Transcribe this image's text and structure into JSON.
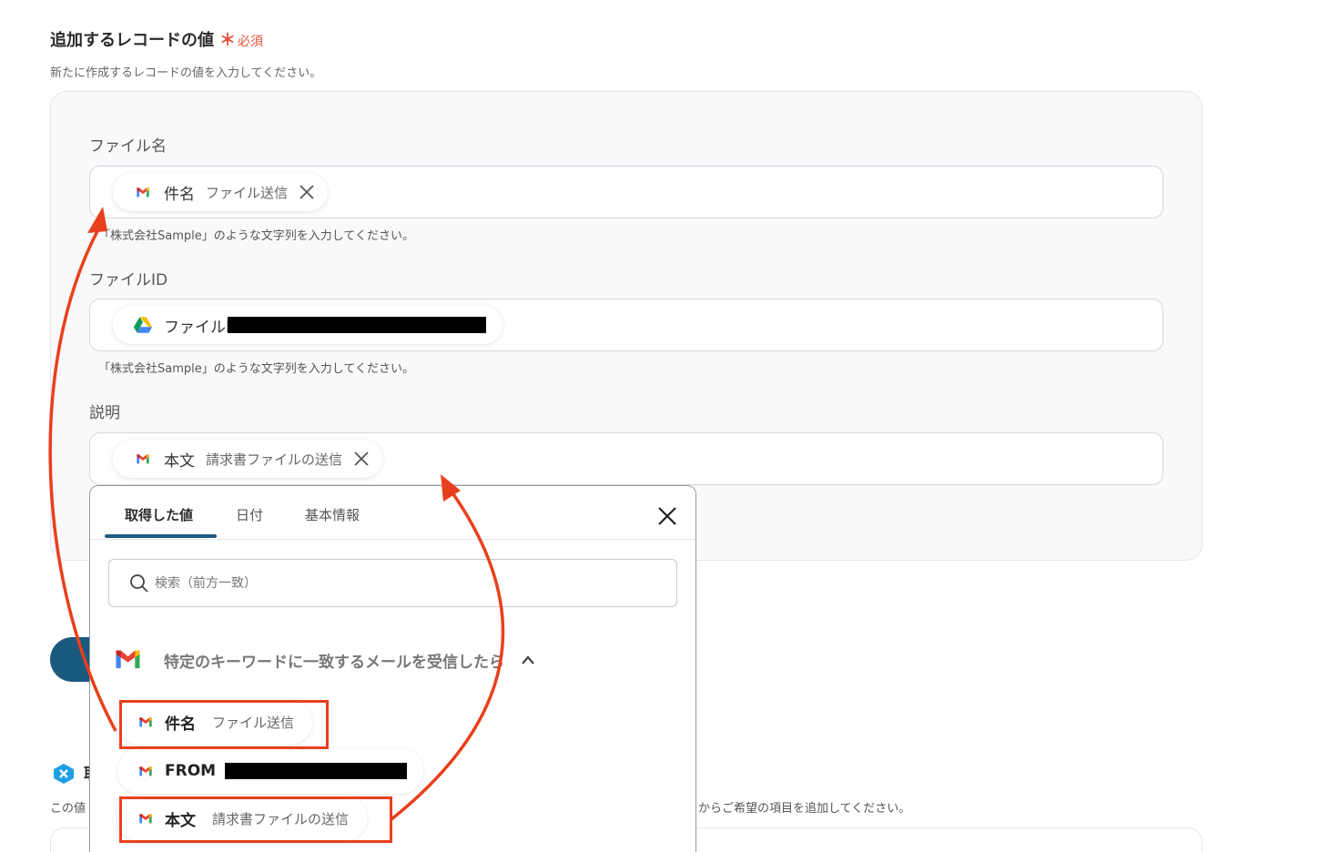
{
  "section": {
    "title": "追加するレコードの値",
    "required_star": "＊",
    "required_label": "必須",
    "description": "新たに作成するレコードの値を入力してください。"
  },
  "fields": [
    {
      "label": "ファイル名",
      "chip_key": "件名",
      "chip_value": "ファイル送信",
      "chip_app": "gmail-icon",
      "hint": "「株式会社Sample」のような文字列を入力してください。"
    },
    {
      "label": "ファイルID",
      "chip_key": "ファイルID",
      "chip_value": "",
      "chip_app": "google-drive-icon",
      "hint": "「株式会社Sample」のような文字列を入力してください。"
    },
    {
      "label": "説明",
      "chip_key": "本文",
      "chip_value": "請求書ファイルの送信",
      "chip_app": "gmail-icon"
    }
  ],
  "dropdown": {
    "tabs": [
      "取得した値",
      "日付",
      "基本情報"
    ],
    "active_tab": 0,
    "search_placeholder": "検索（前方一致）",
    "group_title": "特定のキーワードに一致するメールを受信したら",
    "items": [
      {
        "key": "件名",
        "value": "ファイル送信",
        "highlighted": true
      },
      {
        "key": "FROM",
        "value": "",
        "highlighted": false
      },
      {
        "key": "本文",
        "value": "請求書ファイルの送信",
        "highlighted": true
      }
    ]
  },
  "background": {
    "section_initial": "取",
    "desc_left": "この値",
    "desc_right": "からご希望の項目を追加してください。"
  },
  "colors": {
    "accent": "#1c5a7c",
    "required": "#e8513b",
    "annotation": "#e8401c"
  }
}
